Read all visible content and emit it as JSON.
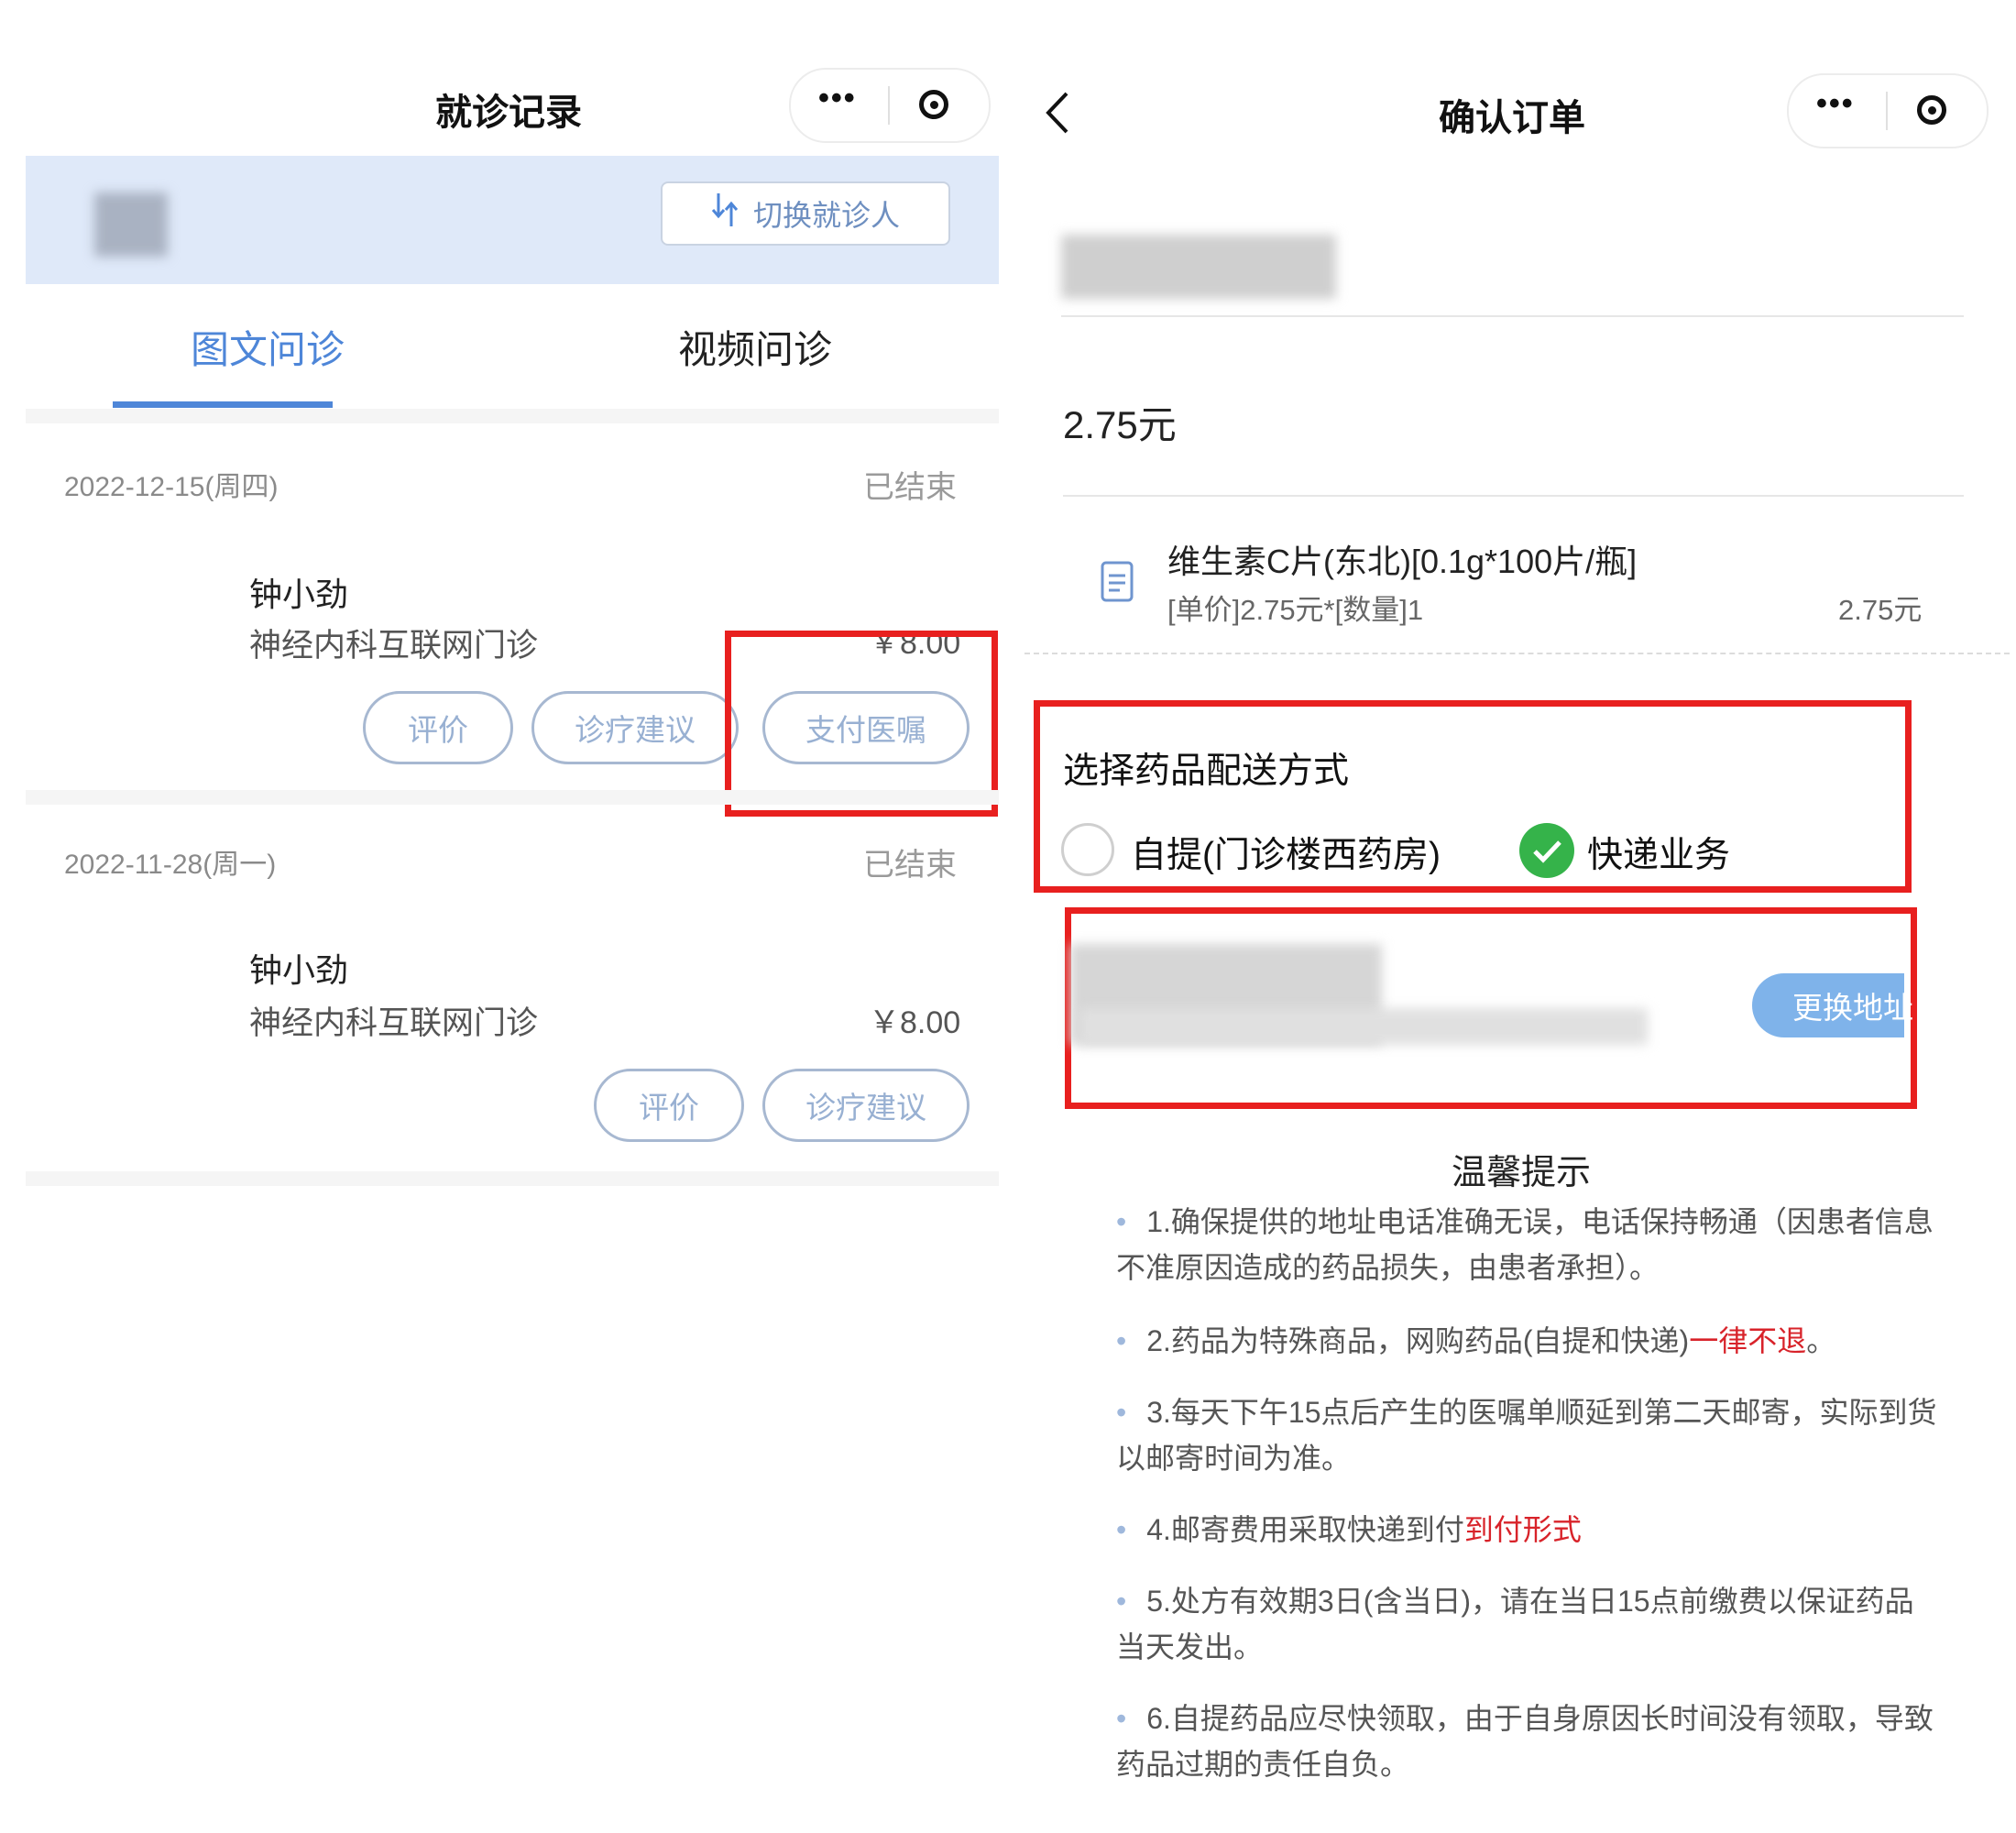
{
  "left": {
    "title": "就诊记录",
    "capsule": {
      "more_icon": "more-dots-icon",
      "close_icon": "target-circle-icon"
    },
    "switch_button": "切换就诊人",
    "tabs": [
      {
        "label": "图文问诊",
        "active": true
      },
      {
        "label": "视频问诊",
        "active": false
      }
    ],
    "records": [
      {
        "date": "2022-12-15(周四)",
        "status": "已结束",
        "doctor": "钟小劲",
        "department": "神经内科互联网门诊",
        "price": "￥8.00",
        "actions": [
          "评价",
          "诊疗建议",
          "支付医嘱"
        ]
      },
      {
        "date": "2022-11-28(周一)",
        "status": "已结束",
        "doctor": "钟小劲",
        "department": "神经内科互联网门诊",
        "price": "￥8.00",
        "actions": [
          "评价",
          "诊疗建议"
        ]
      }
    ]
  },
  "right": {
    "title": "确认订单",
    "amount": "2.75元",
    "drug": {
      "name": "维生素C片(东北)[0.1g*100片/瓶]",
      "unit_qty": "[单价]2.75元*[数量]1",
      "subtotal": "2.75元"
    },
    "delivery": {
      "title": "选择药品配送方式",
      "options": [
        {
          "label": "自提(门诊楼西药房)",
          "selected": false
        },
        {
          "label": "快递业务",
          "selected": true
        }
      ]
    },
    "change_address": "更换地址",
    "tips": {
      "title": "温馨提示",
      "items": [
        {
          "text": "1.确保提供的地址电话准确无误，电话保持畅通（因患者信息不准原因造成的药品损失，由患者承担）。"
        },
        {
          "text": "2.药品为特殊商品，网购药品(自提和快递)",
          "highlight": "一律不退",
          "suffix": "。"
        },
        {
          "text": "3.每天下午15点后产生的医嘱单顺延到第二天邮寄，实际到货以邮寄时间为准。"
        },
        {
          "text": "4.邮寄费用采取快递到付",
          "highlight": "到付形式",
          "suffix": ""
        },
        {
          "text": "5.处方有效期3日(含当日)，请在当日15点前缴费以保证药品当天发出。"
        },
        {
          "text": "6.自提药品应尽快领取，由于自身原因长时间没有领取，导致药品过期的责任自负。"
        }
      ]
    }
  },
  "colors": {
    "accent": "#4e86d8",
    "header_band": "#dfe9f9",
    "annotation_red": "#e8201f",
    "checked_green": "#35b34a",
    "warning_red": "#d8232a"
  }
}
